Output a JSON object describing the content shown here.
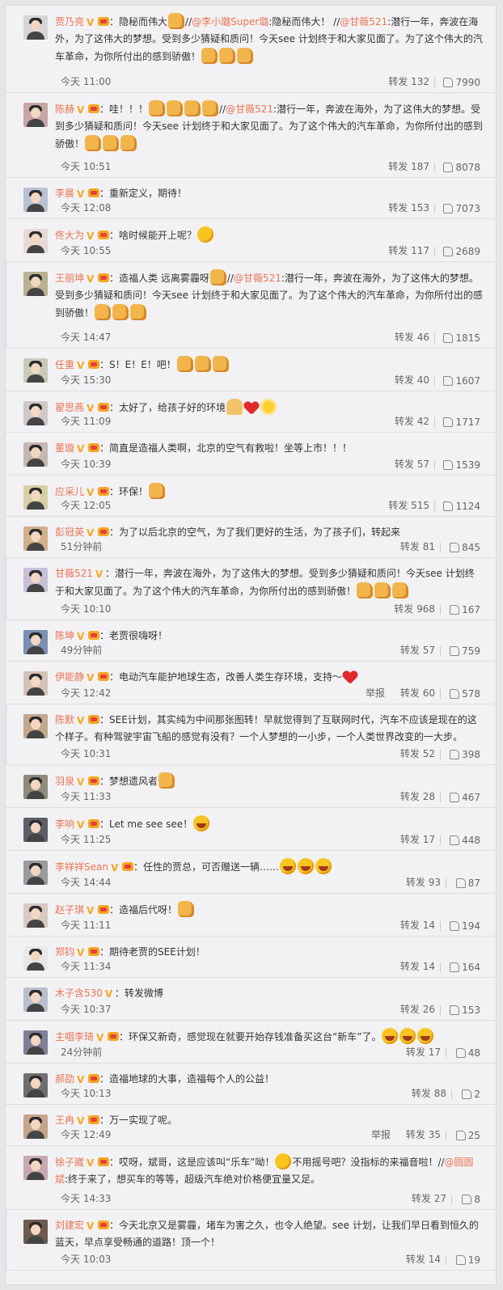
{
  "repost_label": "转发",
  "report_label": "举报",
  "comments": [
    {
      "user": "贾乃亮",
      "badges": [
        "v",
        "vip"
      ],
      "text": [
        {
          "t": "：隐秘而伟大"
        },
        {
          "e": "thumb"
        },
        {
          "t": "//"
        },
        {
          "m": "@李小璐Super璐"
        },
        {
          "t": ":隐秘而伟大！ //"
        },
        {
          "m": "@甘薇521"
        },
        {
          "t": ":潜行一年，奔波在海外，为了这伟大的梦想。受到多少猜疑和质问！今天see 计划终于和大家见面了。为了这个伟大的汽车革命，为你所付出的感到骄傲！"
        },
        {
          "e": "thumb"
        },
        {
          "e": "thumb"
        },
        {
          "e": "thumb"
        }
      ],
      "time": "今天 11:00",
      "reposts": "132",
      "likes": "7990",
      "h": 108,
      "av": "#d6d6d6"
    },
    {
      "user": "陈赫",
      "badges": [
        "v",
        "vip"
      ],
      "text": [
        {
          "t": "：哇！！！"
        },
        {
          "e": "thumb"
        },
        {
          "e": "thumb"
        },
        {
          "e": "thumb"
        },
        {
          "e": "thumb"
        },
        {
          "t": "//"
        },
        {
          "m": "@甘薇521"
        },
        {
          "t": ":潜行一年，奔波在海外，为了这伟大的梦想。受到多少猜疑和质问！今天see 计划终于和大家见面了。为了这个伟大的汽车革命，为你所付出的感到骄傲！"
        },
        {
          "e": "thumb"
        },
        {
          "e": "thumb"
        },
        {
          "e": "thumb"
        }
      ],
      "time": "今天 10:51",
      "reposts": "187",
      "likes": "8078",
      "h": 105,
      "av": "#c7a6a6"
    },
    {
      "user": "李晨",
      "badges": [
        "v",
        "vip"
      ],
      "text": [
        {
          "t": "：重新定义，期待！"
        }
      ],
      "time": "今天 12:08",
      "reposts": "153",
      "likes": "7073",
      "h": 51,
      "av": "#b9c2d2"
    },
    {
      "user": "佟大为",
      "badges": [
        "v",
        "vip"
      ],
      "text": [
        {
          "t": "：啥时候能开上呢？"
        },
        {
          "e": "sweat"
        }
      ],
      "time": "今天 10:55",
      "reposts": "117",
      "likes": "2689",
      "h": 53,
      "av": "#e8d8d8"
    },
    {
      "user": "王丽坤",
      "badges": [
        "v",
        "vip"
      ],
      "text": [
        {
          "t": "：造福人类 远离雾霾呀"
        },
        {
          "e": "thumb"
        },
        {
          "t": "//"
        },
        {
          "m": "@甘薇521"
        },
        {
          "t": ":潜行一年，奔波在海外，为了这伟大的梦想。受到多少猜疑和质问！今天see 计划终于和大家见面了。为了这个伟大的汽车革命，为你所付出的感到骄傲！"
        },
        {
          "e": "thumb"
        },
        {
          "e": "thumb"
        },
        {
          "e": "thumb"
        }
      ],
      "time": "今天 14:47",
      "reposts": "46",
      "likes": "1815",
      "h": 107,
      "av": "#b7b28f",
      "bar": true
    },
    {
      "user": "任重",
      "badges": [
        "v",
        "vip"
      ],
      "text": [
        {
          "t": "：S！E！E！吧！"
        },
        {
          "e": "thumb"
        },
        {
          "e": "thumb"
        },
        {
          "e": "thumb"
        }
      ],
      "time": "今天 15:30",
      "reposts": "40",
      "likes": "1607",
      "h": 53,
      "av": "#c9c9b8"
    },
    {
      "user": "翟思燕",
      "badges": [
        "v",
        "vip"
      ],
      "text": [
        {
          "t": "：太好了，给孩子好的环境"
        },
        {
          "e": "pray"
        },
        {
          "e": "heart"
        },
        {
          "e": "sun"
        }
      ],
      "time": "今天 11:09",
      "reposts": "42",
      "likes": "1717",
      "h": 51,
      "av": "#d0c8c8"
    },
    {
      "user": "董璇",
      "badges": [
        "v",
        "vip"
      ],
      "text": [
        {
          "t": "：简直是造福人类啊，北京的空气有救啦！坐等上市！！！"
        }
      ],
      "time": "今天 10:39",
      "reposts": "57",
      "likes": "1539",
      "h": 53,
      "av": "#c6b8b0"
    },
    {
      "user": "应采儿",
      "badges": [
        "v",
        "vip"
      ],
      "text": [
        {
          "t": "：环保！"
        },
        {
          "e": "thumb"
        }
      ],
      "time": "今天 12:05",
      "reposts": "515",
      "likes": "1124",
      "h": 51,
      "av": "#d8cfa5"
    },
    {
      "user": "彭冠英",
      "badges": [
        "v",
        "vip"
      ],
      "text": [
        {
          "t": "：为了以后北京的空气，为了我们更好的生活，为了孩子们，转起来"
        }
      ],
      "time": "51分钟前",
      "reposts": "81",
      "likes": "845",
      "h": 51,
      "av": "#d1b08a"
    },
    {
      "user": "甘薇521",
      "badges": [
        "v"
      ],
      "text": [
        {
          "t": "：潜行一年，奔波在海外，为了这伟大的梦想。受到多少猜疑和质问！今天see 计划终于和大家见面了。为了这个伟大的汽车革命，为你所付出的感到骄傲！"
        },
        {
          "e": "thumb"
        },
        {
          "e": "thumb"
        },
        {
          "e": "thumb"
        }
      ],
      "time": "今天 10:10",
      "reposts": "968",
      "likes": "167",
      "h": 77,
      "av": "#c8c0d8",
      "bar": true
    },
    {
      "user": "陈坤",
      "badges": [
        "v",
        "vip"
      ],
      "text": [
        {
          "t": "：老贾很嗨呀！"
        }
      ],
      "time": "49分钟前",
      "reposts": "57",
      "likes": "759",
      "h": 51,
      "av": "#7a8fb3"
    },
    {
      "user": "伊能静",
      "badges": [
        "v",
        "vip"
      ],
      "text": [
        {
          "t": "：电动汽车能护地球生态，改善人类生存环境，支持～"
        },
        {
          "e": "heart"
        }
      ],
      "time": "今天 12:42",
      "reposts": "60",
      "likes": "578",
      "h": 53,
      "av": "#d5c1b8",
      "report": true
    },
    {
      "user": "陈默",
      "badges": [
        "v",
        "vip"
      ],
      "text": [
        {
          "t": "：SEE计划，其实纯为中间那张图转！早就觉得到了互联网时代，汽车不应该是现在的这个样子。有种驾驶宇宙飞船的感觉有没有？一个人梦想的一小步，一个人类世界改变的一大步。"
        }
      ],
      "time": "今天 10:31",
      "reposts": "52",
      "likes": "398",
      "h": 75,
      "av": "#c2a98e",
      "bar": true
    },
    {
      "user": "羽泉",
      "badges": [
        "v",
        "vip"
      ],
      "text": [
        {
          "t": "：梦想遗风者"
        },
        {
          "e": "thumb"
        }
      ],
      "time": "今天 11:33",
      "reposts": "28",
      "likes": "467",
      "h": 53,
      "av": "#8f8a7a"
    },
    {
      "user": "李响",
      "badges": [
        "v",
        "vip"
      ],
      "text": [
        {
          "t": "：Let me see see！"
        },
        {
          "e": "laugh"
        }
      ],
      "time": "今天 11:25",
      "reposts": "17",
      "likes": "448",
      "h": 53,
      "av": "#5e5e66"
    },
    {
      "user": "李祥祥Sean",
      "badges": [
        "v",
        "vip"
      ],
      "text": [
        {
          "t": "：任性的贾总，可否赠送一辆……"
        },
        {
          "e": "laugh"
        },
        {
          "e": "laugh"
        },
        {
          "e": "laugh"
        }
      ],
      "time": "今天 14:44",
      "reposts": "93",
      "likes": "87",
      "h": 53,
      "av": "#9b9b9b"
    },
    {
      "user": "赵子琪",
      "badges": [
        "v",
        "vip"
      ],
      "text": [
        {
          "t": "：造福后代呀！"
        },
        {
          "e": "thumb"
        }
      ],
      "time": "今天 11:11",
      "reposts": "14",
      "likes": "194",
      "h": 53,
      "av": "#d8c9c2"
    },
    {
      "user": "郑钧",
      "badges": [
        "v",
        "vip"
      ],
      "text": [
        {
          "t": "：期待老贾的SEE计划！"
        }
      ],
      "time": "今天 11:34",
      "reposts": "14",
      "likes": "164",
      "h": 51,
      "av": "#e8e8e8"
    },
    {
      "user": "木子含530",
      "badges": [
        "v"
      ],
      "text": [
        {
          "t": "：转发微博"
        }
      ],
      "time": "今天 10:37",
      "reposts": "26",
      "likes": "153",
      "h": 53,
      "av": "#b8bfcc"
    },
    {
      "user": "主唱李琦",
      "badges": [
        "v",
        "vip"
      ],
      "text": [
        {
          "t": "：环保又新奇，感觉现在就要开始存钱准备买这台“新车”了。"
        },
        {
          "e": "grin"
        },
        {
          "e": "grin"
        },
        {
          "e": "grin"
        }
      ],
      "time": "24分钟前",
      "reposts": "17",
      "likes": "48",
      "h": 53,
      "av": "#7f7f99"
    },
    {
      "user": "郝劭",
      "badges": [
        "v",
        "vip"
      ],
      "text": [
        {
          "t": "：造福地球的大事，造福每个人的公益！"
        }
      ],
      "time": "今天 10:13",
      "reposts": "88",
      "likes": "2",
      "h": 51,
      "av": "#6f6f6f"
    },
    {
      "user": "王冉",
      "badges": [
        "v",
        "vip"
      ],
      "text": [
        {
          "t": "：万一实现了呢。"
        }
      ],
      "time": "今天 12:49",
      "reposts": "35",
      "likes": "25",
      "h": 51,
      "av": "#c5a58a",
      "report": true
    },
    {
      "user": "徐子崴",
      "badges": [
        "v",
        "vip"
      ],
      "text": [
        {
          "t": "：哎呀，斌哥，这是应该叫“乐车”呦！"
        },
        {
          "e": "wink"
        },
        {
          "t": "不用摇号吧？没指标的来福音啦！//"
        },
        {
          "m": "@圆圆斌"
        },
        {
          "t": ":终于来了，想买车的等等，超级汽车绝对价格便宜量又足。"
        }
      ],
      "time": "今天 14:33",
      "reposts": "27",
      "likes": "8",
      "h": 79,
      "av": "#c9a9b0"
    },
    {
      "user": "刘建宏",
      "badges": [
        "v",
        "vip"
      ],
      "text": [
        {
          "t": "：今天北京又是雾霾，堵车为害之久，也令人绝望。see 计划，让我们早日看到恒久的蓝天，早点享受畅通的道路！顶一个！"
        }
      ],
      "time": "今天 10:03",
      "reposts": "14",
      "likes": "19",
      "h": 75,
      "av": "#6f5a4e",
      "bar": true
    }
  ]
}
